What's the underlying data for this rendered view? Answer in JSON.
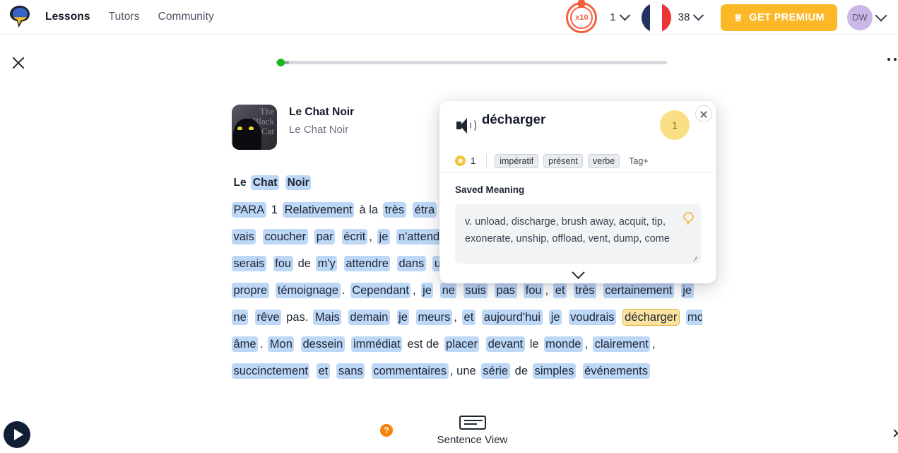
{
  "header": {
    "logo_icon": "lingq-logo-icon",
    "nav": [
      {
        "label": "Lessons",
        "active": true
      },
      {
        "label": "Tutors",
        "active": false
      },
      {
        "label": "Community",
        "active": false
      }
    ],
    "streak": {
      "multiplier": "x10",
      "count": "1"
    },
    "language": {
      "flag": "france-flag-icon",
      "known_words": "38"
    },
    "premium_button": {
      "label": "GET PREMIUM",
      "icon": "crown-icon",
      "color": "#fcb827"
    },
    "avatar": {
      "initials": "DW",
      "color": "#cbb8e6"
    }
  },
  "subbar": {
    "close_icon": "close-icon",
    "progress_percent": 3,
    "more_icon": "ellipsis-icon"
  },
  "lesson": {
    "cover": {
      "line1": "The",
      "line2": "Black",
      "line3": "Cat",
      "icon": "black-cat-cover-icon"
    },
    "title": "Le Chat Noir",
    "subtitle": "Le Chat Noir"
  },
  "reader": {
    "heading": [
      {
        "t": "Le ",
        "s": "plain"
      },
      {
        "t": "Chat",
        "s": "hl"
      },
      {
        "t": " ",
        "s": "plain"
      },
      {
        "t": "Noir",
        "s": "hl"
      }
    ],
    "lines": [
      [
        {
          "t": "PARA",
          "s": "hl"
        },
        {
          "t": " 1 ",
          "s": "plain"
        },
        {
          "t": "Relativement",
          "s": "hl"
        },
        {
          "t": " à la ",
          "s": "plain"
        },
        {
          "t": "très",
          "s": "hl"
        },
        {
          "t": " ",
          "s": "plain"
        },
        {
          "t": "étra",
          "s": "hl"
        }
      ],
      [
        {
          "t": "vais",
          "s": "hl"
        },
        {
          "t": " ",
          "s": "plain"
        },
        {
          "t": "coucher",
          "s": "hl"
        },
        {
          "t": " ",
          "s": "plain"
        },
        {
          "t": "par",
          "s": "hl"
        },
        {
          "t": " ",
          "s": "plain"
        },
        {
          "t": "écrit",
          "s": "hl"
        },
        {
          "t": ", ",
          "s": "plain"
        },
        {
          "t": "je",
          "s": "hl"
        },
        {
          "t": " ",
          "s": "plain"
        },
        {
          "t": "n'attends",
          "s": "hl"
        }
      ],
      [
        {
          "t": "serais",
          "s": "hl"
        },
        {
          "t": " ",
          "s": "plain"
        },
        {
          "t": "fou",
          "s": "hl"
        },
        {
          "t": " de ",
          "s": "plain"
        },
        {
          "t": "m'y",
          "s": "hl"
        },
        {
          "t": " ",
          "s": "plain"
        },
        {
          "t": "attendre",
          "s": "hl"
        },
        {
          "t": " ",
          "s": "plain"
        },
        {
          "t": "dans",
          "s": "hl"
        },
        {
          "t": " ",
          "s": "plain"
        },
        {
          "t": "un",
          "s": "hl"
        }
      ],
      [
        {
          "t": "propre",
          "s": "hl"
        },
        {
          "t": " ",
          "s": "plain"
        },
        {
          "t": "témoignage",
          "s": "hl"
        },
        {
          "t": ".  ",
          "s": "plain"
        },
        {
          "t": "Cependant",
          "s": "hl"
        },
        {
          "t": ", ",
          "s": "plain"
        },
        {
          "t": "je",
          "s": "hl"
        },
        {
          "t": " ",
          "s": "plain"
        },
        {
          "t": "ne",
          "s": "hl"
        },
        {
          "t": " ",
          "s": "plain"
        },
        {
          "t": "suis",
          "s": "hl"
        },
        {
          "t": " ",
          "s": "plain"
        },
        {
          "t": "pas",
          "s": "hl"
        },
        {
          "t": " ",
          "s": "plain"
        },
        {
          "t": "fou",
          "s": "hl"
        },
        {
          "t": ",   ",
          "s": "plain"
        },
        {
          "t": "et",
          "s": "hl"
        },
        {
          "t": " ",
          "s": "plain"
        },
        {
          "t": "très",
          "s": "hl"
        },
        {
          "t": " ",
          "s": "plain"
        },
        {
          "t": "certainement",
          "s": "hl"
        },
        {
          "t": " ",
          "s": "plain"
        },
        {
          "t": "je",
          "s": "hl"
        }
      ],
      [
        {
          "t": "ne",
          "s": "hl"
        },
        {
          "t": " ",
          "s": "plain"
        },
        {
          "t": "rêve",
          "s": "hl"
        },
        {
          "t": " pas. ",
          "s": "plain"
        },
        {
          "t": "Mais",
          "s": "hl"
        },
        {
          "t": " ",
          "s": "plain"
        },
        {
          "t": "demain",
          "s": "hl"
        },
        {
          "t": " ",
          "s": "plain"
        },
        {
          "t": "je",
          "s": "hl"
        },
        {
          "t": " ",
          "s": "plain"
        },
        {
          "t": "meurs",
          "s": "hl"
        },
        {
          "t": ", ",
          "s": "plain"
        },
        {
          "t": "et",
          "s": "hl"
        },
        {
          "t": " ",
          "s": "plain"
        },
        {
          "t": "aujourd'hui",
          "s": "hl"
        },
        {
          "t": " ",
          "s": "plain"
        },
        {
          "t": "je",
          "s": "hl"
        },
        {
          "t": " ",
          "s": "plain"
        },
        {
          "t": "voudrais",
          "s": "hl"
        },
        {
          "t": " ",
          "s": "plain"
        },
        {
          "t": "décharger",
          "s": "sel"
        },
        {
          "t": " ",
          "s": "plain"
        },
        {
          "t": "mon",
          "s": "hl"
        }
      ],
      [
        {
          "t": "âme",
          "s": "hl"
        },
        {
          "t": ". ",
          "s": "plain"
        },
        {
          "t": "Mon",
          "s": "hl"
        },
        {
          "t": " ",
          "s": "plain"
        },
        {
          "t": "dessein",
          "s": "hl"
        },
        {
          "t": " ",
          "s": "plain"
        },
        {
          "t": "immédiat",
          "s": "hl"
        },
        {
          "t": " est de ",
          "s": "plain"
        },
        {
          "t": "placer",
          "s": "hl"
        },
        {
          "t": " ",
          "s": "plain"
        },
        {
          "t": "devant",
          "s": "hl"
        },
        {
          "t": " le ",
          "s": "plain"
        },
        {
          "t": "monde",
          "s": "hl"
        },
        {
          "t": ", ",
          "s": "plain"
        },
        {
          "t": "clairement",
          "s": "hl"
        },
        {
          "t": ",",
          "s": "plain"
        }
      ],
      [
        {
          "t": "succinctement",
          "s": "hl"
        },
        {
          "t": " ",
          "s": "plain"
        },
        {
          "t": "et",
          "s": "hl"
        },
        {
          "t": " ",
          "s": "plain"
        },
        {
          "t": "sans",
          "s": "hl"
        },
        {
          "t": " ",
          "s": "plain"
        },
        {
          "t": "commentaires",
          "s": "hl"
        },
        {
          "t": ", une ",
          "s": "plain"
        },
        {
          "t": "série",
          "s": "hl"
        },
        {
          "t": " de ",
          "s": "plain"
        },
        {
          "t": "simples",
          "s": "hl"
        },
        {
          "t": " ",
          "s": "plain"
        },
        {
          "t": "événements",
          "s": "hl"
        }
      ]
    ]
  },
  "popup": {
    "speaker_icon": "speaker-icon",
    "word": "décharger",
    "status_badge": "1",
    "close_icon": "close-icon",
    "coin_count": "1",
    "tags": [
      "impératif",
      "présent",
      "verbe"
    ],
    "add_tag_label": "Tag+",
    "saved_meaning_label": "Saved Meaning",
    "meaning_text": "v. unload, discharge, brush away, acquit, tip, exonerate, unship, offload, vent, dump, come",
    "expand_icon": "chevron-down-icon",
    "badge_color": "#fbdf86",
    "selected_word_color": "#fbe2a0"
  },
  "footer": {
    "play_icon": "play-icon",
    "help_label": "?",
    "sentence_view_label": "Sentence View",
    "sentence_view_icon": "sentence-view-icon"
  }
}
